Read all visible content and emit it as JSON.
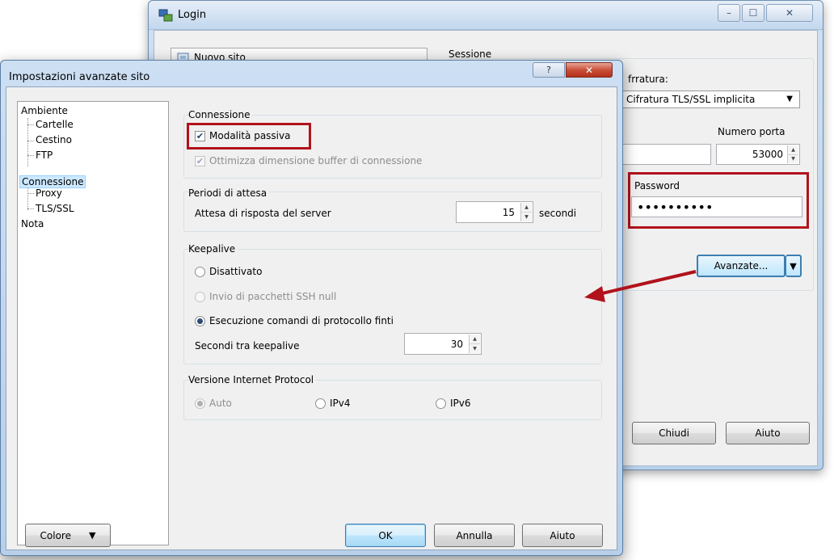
{
  "back_window": {
    "title": "Login",
    "controls": {
      "minimize": "–",
      "maximize": "☐",
      "close": "✕"
    },
    "site_button": "Nuovo sito",
    "session_label": "Sessione",
    "encryption_label": "frratura:",
    "encryption_value": "Cifratura TLS/SSL implicita",
    "port_label": "Numero porta",
    "port_value": "53000",
    "password_label": "Password",
    "password_mask": "••••••••••",
    "advanced_button": "Avanzate...",
    "close_button": "Chiudi",
    "help_button": "Aiuto"
  },
  "dialog": {
    "title": "Impostazioni avanzate sito",
    "help_glyph": "?",
    "close_glyph": "✕",
    "tree": {
      "ambiente": "Ambiente",
      "cartelle": "Cartelle",
      "cestino": "Cestino",
      "ftp": "FTP",
      "connessione": "Connessione",
      "proxy": "Proxy",
      "tls": "TLS/SSL",
      "nota": "Nota"
    },
    "connessione_group": {
      "title": "Connessione",
      "passive_mode": "Modalità passiva",
      "passive_checked": true,
      "optimize_buffer": "Ottimizza dimensione buffer di connessione",
      "optimize_checked": true
    },
    "timeouts_group": {
      "title": "Periodi di attesa",
      "label": "Attesa di risposta del server",
      "value": "15",
      "unit": "secondi"
    },
    "keepalive_group": {
      "title": "Keepalive",
      "off": "Disattivato",
      "ssh_null": "Invio di pacchetti SSH null",
      "dummy_cmds": "Esecuzione comandi di protocollo finti",
      "selected": "dummy_cmds",
      "interval_label": "Secondi tra keepalive",
      "interval_value": "30"
    },
    "ip_group": {
      "title": "Versione Internet Protocol",
      "auto": "Auto",
      "ipv4": "IPv4",
      "ipv6": "IPv6",
      "selected": "auto"
    },
    "buttons": {
      "color": "Colore",
      "ok": "OK",
      "cancel": "Annulla",
      "help": "Aiuto"
    }
  },
  "annotation": {
    "arrow_color": "#b1121c"
  }
}
